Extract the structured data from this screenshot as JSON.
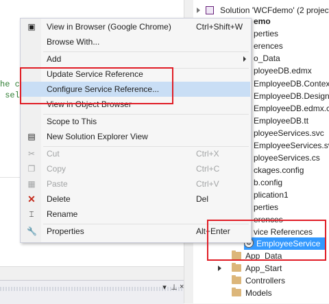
{
  "editor": {
    "code_lines": [
      "he c",
      " sel"
    ]
  },
  "panel": {
    "buttons": [
      "▾",
      "⊥",
      "×"
    ]
  },
  "explorer": {
    "solution_label": "Solution 'WCFdemo' (2 project",
    "items": [
      {
        "text": "emo",
        "bold": true
      },
      {
        "text": "perties"
      },
      {
        "text": "erences"
      },
      {
        "text": "o_Data"
      },
      {
        "text": "ployeeDB.edmx"
      },
      {
        "text": "EmployeeDB.Contex"
      },
      {
        "text": "EmployeeDB.Design"
      },
      {
        "text": "EmployeeDB.edmx.c"
      },
      {
        "text": "EmployeeDB.tt"
      },
      {
        "text": "ployeeServices.svc"
      },
      {
        "text": "EmployeeServices.sv"
      },
      {
        "text": "ployeeServices.cs"
      },
      {
        "text": "ckages.config"
      },
      {
        "text": "b.config"
      },
      {
        "text": "plication1"
      },
      {
        "text": "perties"
      },
      {
        "text": "erences"
      },
      {
        "text": "vice References"
      }
    ],
    "employee_service": "EmployeeService",
    "folders": [
      "App_Data",
      "App_Start",
      "Controllers",
      "Models"
    ]
  },
  "menu": {
    "view_browser": {
      "label": "View in Browser (Google Chrome)",
      "shortcut": "Ctrl+Shift+W"
    },
    "browse_with": {
      "label": "Browse With..."
    },
    "add": {
      "label": "Add"
    },
    "update_ref": {
      "label": "Update Service Reference"
    },
    "configure_ref": {
      "label": "Configure Service Reference..."
    },
    "view_object": {
      "label": "View in Object Browser"
    },
    "scope": {
      "label": "Scope to This"
    },
    "new_explorer": {
      "label": "New Solution Explorer View"
    },
    "cut": {
      "label": "Cut",
      "shortcut": "Ctrl+X"
    },
    "copy": {
      "label": "Copy",
      "shortcut": "Ctrl+C"
    },
    "paste": {
      "label": "Paste",
      "shortcut": "Ctrl+V"
    },
    "delete": {
      "label": "Delete",
      "shortcut": "Del"
    },
    "rename": {
      "label": "Rename"
    },
    "properties": {
      "label": "Properties",
      "shortcut": "Alt+Enter"
    }
  },
  "colors": {
    "highlight": "#c9def5",
    "selection": "#3399ff",
    "annotation": "#e01b24",
    "delete_icon": "#c42b1c"
  }
}
